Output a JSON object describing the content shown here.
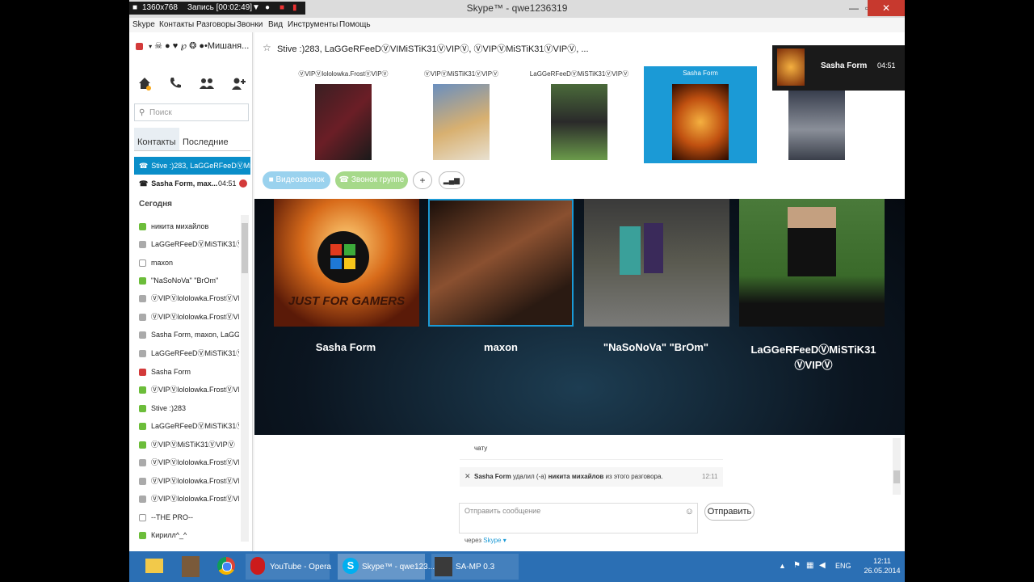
{
  "recorder": {
    "resolution": "1360x768",
    "recording": "Запись [00:02:49]"
  },
  "window": {
    "title": "Skype™ - qwe1236319",
    "minimize": "—",
    "maximize": "▫",
    "close": "✕"
  },
  "menu": [
    "Skype",
    "Контакты",
    "Разговоры",
    "Звонки",
    "Вид",
    "Инструменты",
    "Помощь"
  ],
  "user": {
    "name": "☠ ● ♥ ℘ ❂ ●•Мишаня..."
  },
  "search": {
    "placeholder": "Поиск"
  },
  "tabs": {
    "contacts": "Контакты",
    "recent": "Последние"
  },
  "active_conversations": [
    {
      "name": "Stive :)283, LaGGeRFeeDⓋMi...",
      "selected": true
    },
    {
      "name": "Sasha Form, max...",
      "time": "04:51"
    }
  ],
  "section_today": "Сегодня",
  "contacts": [
    {
      "name": "никита михайлов",
      "status": "green"
    },
    {
      "name": "LaGGeRFeeDⓋMiSTiK31ⓋVIP...",
      "status": "group"
    },
    {
      "name": "maxon",
      "status": "outline"
    },
    {
      "name": "\"NaSoNoVa\" \"BrOm\"",
      "status": "green"
    },
    {
      "name": "ⓋVIPⓋlololowka.FrostⓋVIP...",
      "status": "group"
    },
    {
      "name": "ⓋVIPⓋlololowka.FrostⓋVIP...",
      "status": "group"
    },
    {
      "name": "Sasha Form, maxon, LaGGe...",
      "status": "group"
    },
    {
      "name": "LaGGeRFeeDⓋMiSTiK31ⓋVIP...",
      "status": "group"
    },
    {
      "name": "Sasha Form",
      "status": "red"
    },
    {
      "name": "ⓋVIPⓋlololowka.FrostⓋVIPⓋ",
      "status": "green"
    },
    {
      "name": "Stive :)283",
      "status": "green"
    },
    {
      "name": "LaGGeRFeeDⓋMiSTiK31ⓋVIP...",
      "status": "green"
    },
    {
      "name": "ⓋVIPⓋMiSTiK31ⓋVIPⓋ",
      "status": "green"
    },
    {
      "name": "ⓋVIPⓋlololowka.FrostⓋVIP...",
      "status": "group"
    },
    {
      "name": "ⓋVIPⓋlololowka.FrostⓋVIP...",
      "status": "group"
    },
    {
      "name": "ⓋVIPⓋlololowka.FrostⓋVIP...",
      "status": "group"
    },
    {
      "name": "--THE PRO--",
      "status": "outline"
    },
    {
      "name": "Кирилл^_^",
      "status": "green"
    }
  ],
  "conversation": {
    "title": "Stive :)283, LaGGeRFeeDⓋVIMiSTiK31ⓋVIPⓋ, ⓋVIPⓋMiSTiK31ⓋVIPⓋ, ...",
    "participants": [
      {
        "name": "ⓋVIPⓋlololowka.FrostⓋVIPⓋ"
      },
      {
        "name": "ⓋVIPⓋMiSTiK31ⓋVIPⓋ"
      },
      {
        "name": "LaGGeRFeeDⓋMiSTiK31ⓋVIPⓋ"
      },
      {
        "name": "Sasha Form",
        "selected": true
      },
      {
        "name": ""
      }
    ],
    "buttons": {
      "video_call": "Видеозвонок",
      "group_call": "Звонок группе",
      "add": "+",
      "signal": "▂▄▆"
    }
  },
  "video_tiles": [
    {
      "name": "Sasha Form",
      "caption": "JUST FOR GAMERS"
    },
    {
      "name": "maxon"
    },
    {
      "name": "\"NaSoNoVa\" \"BrOm\""
    },
    {
      "name": "LaGGeRFeeDⓋMiSTiK31 ⓋVIPⓋ"
    }
  ],
  "chat": {
    "msg1_line2": "чату",
    "msg2_actor": "Sasha Form",
    "msg2_mid": "удалил (-а)",
    "msg2_target": "никита михайлов",
    "msg2_tail": "из этого разговора.",
    "msg2_time": "12:11",
    "input_placeholder": "Отправить сообщение",
    "send": "Отправить",
    "via": "через",
    "via_service": "Skype ▾"
  },
  "popup": {
    "name": "Sasha Form",
    "time": "04:51"
  },
  "taskbar": {
    "items": [
      "YouTube - Opera",
      "Skype™ - qwe123...",
      "SA-MP 0.3"
    ],
    "lang": "ENG",
    "time": "12:11",
    "date": "26.05.2014"
  },
  "colors": {
    "accent": "#1b9ad6",
    "online": "#6cbd3a",
    "busy": "#d33a3a",
    "taskbar": "#2b6fb4"
  }
}
